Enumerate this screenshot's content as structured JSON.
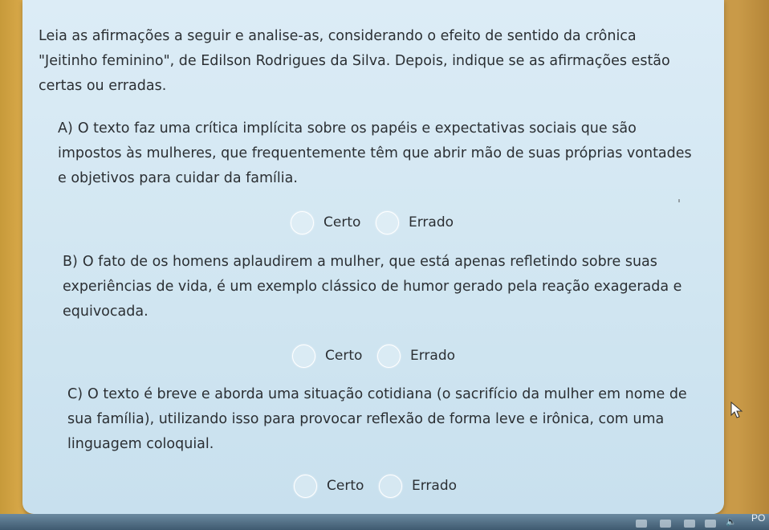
{
  "intro": "Leia as afirmações a seguir e analise-as, considerando o efeito de sentido da crônica \"Jeitinho feminino\", de Edilson Rodrigues da Silva. Depois, indique se as afirmações estão certas ou erradas.",
  "questions": [
    {
      "letter": "A)",
      "text": "O texto faz uma crítica implícita sobre os papéis e expectativas sociais que são impostos às mulheres, que frequentemente têm que abrir mão de suas próprias vontades e objetivos para cuidar da família.",
      "option_true": "Certo",
      "option_false": "Errado"
    },
    {
      "letter": "B)",
      "text": "O fato de os homens aplaudirem a mulher, que está apenas refletindo sobre suas experiências de vida, é um exemplo clássico de humor gerado pela reação exagerada e equivocada.",
      "option_true": "Certo",
      "option_false": "Errado"
    },
    {
      "letter": "C)",
      "text": "O texto é breve e aborda uma situação cotidiana (o sacrifício da mulher em nome de sua família), utilizando isso para provocar reflexão de forma leve e irônica, com uma linguagem coloquial.",
      "option_true": "Certo",
      "option_false": "Errado"
    }
  ],
  "taskbar": {
    "clipped_text": "PO"
  },
  "icons": [
    "radio-icon",
    "cursor-icon",
    "speaker-icon"
  ]
}
